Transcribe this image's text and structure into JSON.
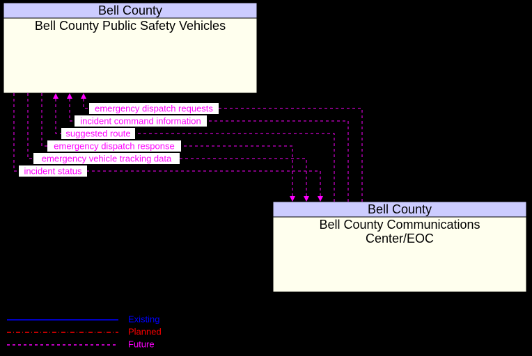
{
  "nodes": {
    "top": {
      "header": "Bell County",
      "title": "Bell County Public Safety Vehicles"
    },
    "bottom": {
      "header": "Bell County",
      "title1": "Bell County Communications",
      "title2": "Center/EOC"
    }
  },
  "flows": {
    "f1": "emergency dispatch requests",
    "f2": "incident command information",
    "f3": "suggested route",
    "f4": "emergency dispatch response",
    "f5": "emergency vehicle tracking data",
    "f6": "incident status"
  },
  "legend": {
    "existing": "Existing",
    "planned": "Planned",
    "future": "Future"
  }
}
